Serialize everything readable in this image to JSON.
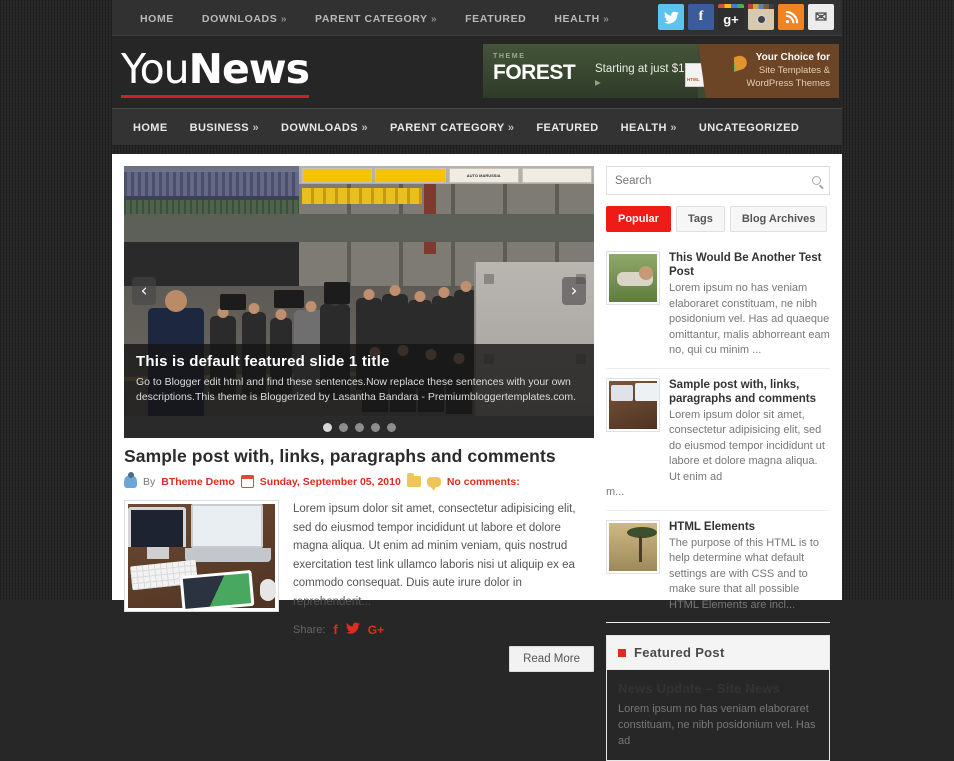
{
  "site": {
    "logo_light": "You",
    "logo_bold": "News"
  },
  "topbar": {
    "items": [
      {
        "label": "HOME",
        "caret": ""
      },
      {
        "label": "DOWNLOADS",
        "caret": "»"
      },
      {
        "label": "PARENT CATEGORY",
        "caret": "»"
      },
      {
        "label": "FEATURED",
        "caret": ""
      },
      {
        "label": "HEALTH",
        "caret": "»"
      }
    ],
    "social": [
      {
        "name": "twitter-icon",
        "glyph": "ᵗ"
      },
      {
        "name": "facebook-icon",
        "glyph": "f"
      },
      {
        "name": "google-plus-icon",
        "glyph": "g+"
      },
      {
        "name": "instagram-icon",
        "glyph": ""
      },
      {
        "name": "rss-icon",
        "glyph": "◠"
      },
      {
        "name": "email-icon",
        "glyph": "✉"
      }
    ]
  },
  "ad": {
    "brand_top": "THEME",
    "brand_bottom": "FOREST",
    "price": "Starting at just $10",
    "arrow": "▸",
    "line1": "Your Choice for",
    "line2": "Site Templates &",
    "line3": "WordPress Themes",
    "doc_label": "HTML",
    "wp_label": "W"
  },
  "mainnav": {
    "items": [
      {
        "label": "HOME",
        "caret": ""
      },
      {
        "label": "BUSINESS",
        "caret": "»"
      },
      {
        "label": "DOWNLOADS",
        "caret": "»"
      },
      {
        "label": "PARENT CATEGORY",
        "caret": "»"
      },
      {
        "label": "FEATURED",
        "caret": ""
      },
      {
        "label": "HEALTH",
        "caret": "»"
      },
      {
        "label": "UNCATEGORIZED",
        "caret": ""
      }
    ]
  },
  "slider": {
    "title": "This is default featured slide 1 title",
    "description": "Go to Blogger edit html and find these sentences.Now replace these sentences with your own descriptions.This theme is Bloggerized by Lasantha Bandara - Premiumbloggertemplates.com.",
    "prev": "‹",
    "next": "›",
    "dots": 5,
    "active_dot": 1,
    "signs": [
      "",
      "",
      "AUTO MARUSSIA",
      ""
    ]
  },
  "post": {
    "title": "Sample post with, links, paragraphs and comments",
    "meta": {
      "by_label": "By",
      "author": "BTheme Demo",
      "date": "Sunday, September 05, 2010",
      "comments": "No comments:"
    },
    "excerpt": "Lorem ipsum dolor sit amet, consectetur adipisicing elit, sed do eiusmod tempor incididunt ut labore et dolore magna aliqua. Ut enim ad minim veniam, quis nostrud exercitation test link ullamco laboris nisi ut aliquip ex ea commodo consequat. Duis aute irure dolor in reprehenderit...",
    "share_label": "Share:",
    "share_icons": [
      {
        "name": "facebook-share-icon",
        "glyph": "f"
      },
      {
        "name": "twitter-share-icon",
        "glyph": "🐦"
      },
      {
        "name": "google-plus-share-icon",
        "glyph": "G+"
      }
    ],
    "read_more": "Read More"
  },
  "sidebar": {
    "search_placeholder": "Search",
    "search_value": "",
    "tabs": [
      {
        "label": "Popular",
        "active": true
      },
      {
        "label": "Tags",
        "active": false
      },
      {
        "label": "Blog Archives",
        "active": false
      }
    ],
    "popular": [
      {
        "title": "This Would Be Another Test Post",
        "excerpt": "Lorem ipsum no has veniam elaboraret constituam, ne nibh posidonium vel. Has ad quaeque omittantur, malis abhorreant eam no, qui cu minim ...",
        "tail": "",
        "thumb": "pushup-photo"
      },
      {
        "title": "Sample post with, links, paragraphs and comments",
        "excerpt": "Lorem ipsum dolor sit amet, consectetur adipisicing elit, sed do eiusmod tempor incididunt ut labore et dolore magna aliqua. Ut enim ad",
        "tail": "m...",
        "thumb": "desk-photo"
      },
      {
        "title": "HTML Elements",
        "excerpt": "The purpose of this HTML is to help determine what default settings are with CSS and to make sure that all possible HTML Elements are incl...",
        "tail": "",
        "thumb": "safari-photo"
      }
    ],
    "featured_widget": {
      "heading": "Featured Post",
      "post_title": "News Update – Site News",
      "post_excerpt": "Lorem ipsum no has veniam elaboraret constituam, ne nibh posidonium vel. Has ad"
    }
  },
  "colors": {
    "accent_red": "#e02b20",
    "tab_red": "#ef1b17",
    "logo_underline": "#cf2027",
    "page_bg": "#272727",
    "nav_bg": "#333333"
  }
}
